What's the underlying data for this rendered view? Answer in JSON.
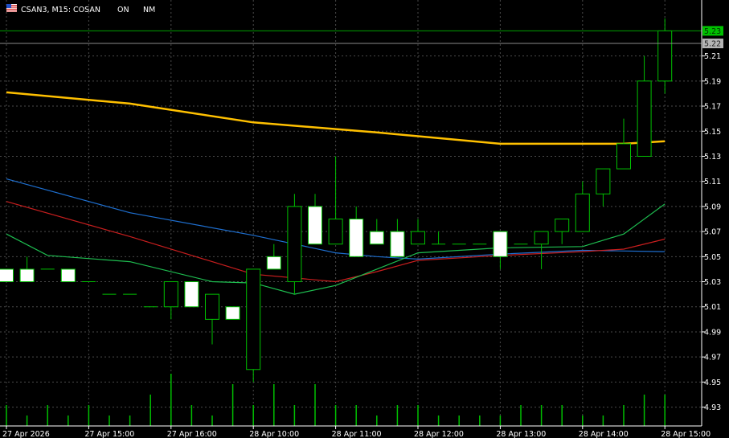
{
  "header": {
    "flag_icon": "flag-icon",
    "symbol_info": "CSAN3, M15:  COSAN",
    "tag_on": "ON",
    "tag_nm": "NM"
  },
  "colors": {
    "background": "#000000",
    "grid": "#4a4a4a",
    "bull_body": "#000000",
    "bull_outline": "#00c000",
    "bear_body": "#ffffff",
    "volume": "#00c000",
    "ma_gold": "#ffc000",
    "ma_blue": "#1e6fd0",
    "ma_red": "#c81e1e",
    "ma_green": "#1ebe50",
    "bid_line": "#00a000",
    "ask_line": "#8a8a8a",
    "bid_label_bg": "#00c000",
    "ask_label_bg": "#b4b4b4"
  },
  "price_labels": {
    "bid": "5.23",
    "ask": "5.22"
  },
  "chart_data": {
    "type": "candlestick",
    "timeframe": "M15",
    "ylim": [
      4.915,
      5.245
    ],
    "y_ticks": [
      "5.21",
      "5.19",
      "5.17",
      "5.15",
      "5.13",
      "5.11",
      "5.09",
      "5.07",
      "5.05",
      "5.03",
      "5.01",
      "4.99",
      "4.97",
      "4.95",
      "4.93"
    ],
    "x_ticks": [
      {
        "bar": 0,
        "label": "27 Apr 2026"
      },
      {
        "bar": 4,
        "label": "27 Apr 15:00"
      },
      {
        "bar": 8,
        "label": "27 Apr 16:00"
      },
      {
        "bar": 12,
        "label": "28 Apr 10:00"
      },
      {
        "bar": 16,
        "label": "28 Apr 11:00"
      },
      {
        "bar": 20,
        "label": "28 Apr 12:00"
      },
      {
        "bar": 24,
        "label": "28 Apr 13:00"
      },
      {
        "bar": 28,
        "label": "28 Apr 14:00"
      },
      {
        "bar": 32,
        "label": "28 Apr 15:00"
      }
    ],
    "candles": [
      {
        "o": 5.04,
        "h": 5.04,
        "l": 5.03,
        "c": 5.03
      },
      {
        "o": 5.04,
        "h": 5.05,
        "l": 5.03,
        "c": 5.03
      },
      {
        "o": 5.04,
        "h": 5.04,
        "l": 5.04,
        "c": 5.04
      },
      {
        "o": 5.04,
        "h": 5.04,
        "l": 5.03,
        "c": 5.03
      },
      {
        "o": 5.03,
        "h": 5.03,
        "l": 5.03,
        "c": 5.03
      },
      {
        "o": 5.02,
        "h": 5.02,
        "l": 5.02,
        "c": 5.02
      },
      {
        "o": 5.02,
        "h": 5.02,
        "l": 5.02,
        "c": 5.02
      },
      {
        "o": 5.01,
        "h": 5.01,
        "l": 5.01,
        "c": 5.01
      },
      {
        "o": 5.01,
        "h": 5.03,
        "l": 5.0,
        "c": 5.03
      },
      {
        "o": 5.03,
        "h": 5.03,
        "l": 5.01,
        "c": 5.01
      },
      {
        "o": 5.0,
        "h": 5.02,
        "l": 4.98,
        "c": 5.02
      },
      {
        "o": 5.01,
        "h": 5.01,
        "l": 5.0,
        "c": 5.0
      },
      {
        "o": 4.96,
        "h": 5.04,
        "l": 4.95,
        "c": 5.04
      },
      {
        "o": 5.05,
        "h": 5.06,
        "l": 5.04,
        "c": 5.04
      },
      {
        "o": 5.03,
        "h": 5.1,
        "l": 5.02,
        "c": 5.09
      },
      {
        "o": 5.09,
        "h": 5.1,
        "l": 5.06,
        "c": 5.06
      },
      {
        "o": 5.06,
        "h": 5.13,
        "l": 5.06,
        "c": 5.08
      },
      {
        "o": 5.08,
        "h": 5.09,
        "l": 5.05,
        "c": 5.05
      },
      {
        "o": 5.07,
        "h": 5.08,
        "l": 5.06,
        "c": 5.06
      },
      {
        "o": 5.07,
        "h": 5.08,
        "l": 5.05,
        "c": 5.05
      },
      {
        "o": 5.06,
        "h": 5.08,
        "l": 5.06,
        "c": 5.07
      },
      {
        "o": 5.06,
        "h": 5.07,
        "l": 5.06,
        "c": 5.06
      },
      {
        "o": 5.06,
        "h": 5.06,
        "l": 5.06,
        "c": 5.06
      },
      {
        "o": 5.06,
        "h": 5.06,
        "l": 5.06,
        "c": 5.06
      },
      {
        "o": 5.07,
        "h": 5.07,
        "l": 5.04,
        "c": 5.05
      },
      {
        "o": 5.06,
        "h": 5.06,
        "l": 5.06,
        "c": 5.06
      },
      {
        "o": 5.06,
        "h": 5.07,
        "l": 5.04,
        "c": 5.07
      },
      {
        "o": 5.07,
        "h": 5.08,
        "l": 5.06,
        "c": 5.08
      },
      {
        "o": 5.07,
        "h": 5.11,
        "l": 5.07,
        "c": 5.1
      },
      {
        "o": 5.1,
        "h": 5.12,
        "l": 5.09,
        "c": 5.12
      },
      {
        "o": 5.12,
        "h": 5.16,
        "l": 5.12,
        "c": 5.14
      },
      {
        "o": 5.13,
        "h": 5.21,
        "l": 5.13,
        "c": 5.19
      },
      {
        "o": 5.19,
        "h": 5.24,
        "l": 5.18,
        "c": 5.23
      }
    ],
    "volume": [
      2,
      1,
      2,
      1,
      2,
      1,
      1,
      3,
      5,
      2,
      1,
      4,
      2,
      4,
      2,
      4,
      2,
      2,
      1,
      2,
      2,
      1,
      1,
      1,
      1,
      2,
      2,
      2,
      1,
      1,
      2,
      3,
      3
    ],
    "moving_averages": [
      {
        "color": "#ffc000",
        "points": [
          [
            0,
            5.181
          ],
          [
            6,
            5.172
          ],
          [
            12,
            5.157
          ],
          [
            18,
            5.149
          ],
          [
            24,
            5.14
          ],
          [
            30,
            5.14
          ],
          [
            32,
            5.142
          ]
        ]
      },
      {
        "color": "#1e6fd0",
        "points": [
          [
            0,
            5.112
          ],
          [
            6,
            5.085
          ],
          [
            12,
            5.067
          ],
          [
            16,
            5.053
          ],
          [
            18,
            5.05
          ],
          [
            20,
            5.048
          ],
          [
            24,
            5.052
          ],
          [
            28,
            5.055
          ],
          [
            32,
            5.054
          ]
        ]
      },
      {
        "color": "#c81e1e",
        "points": [
          [
            0,
            5.094
          ],
          [
            6,
            5.066
          ],
          [
            12,
            5.036
          ],
          [
            16,
            5.03
          ],
          [
            18,
            5.038
          ],
          [
            20,
            5.047
          ],
          [
            24,
            5.051
          ],
          [
            28,
            5.054
          ],
          [
            30,
            5.056
          ],
          [
            32,
            5.064
          ]
        ]
      },
      {
        "color": "#1ebe50",
        "points": [
          [
            0,
            5.068
          ],
          [
            2,
            5.051
          ],
          [
            6,
            5.046
          ],
          [
            10,
            5.03
          ],
          [
            12,
            5.029
          ],
          [
            14,
            5.02
          ],
          [
            16,
            5.027
          ],
          [
            18,
            5.04
          ],
          [
            20,
            5.053
          ],
          [
            24,
            5.057
          ],
          [
            28,
            5.058
          ],
          [
            30,
            5.068
          ],
          [
            32,
            5.092
          ]
        ]
      }
    ]
  }
}
